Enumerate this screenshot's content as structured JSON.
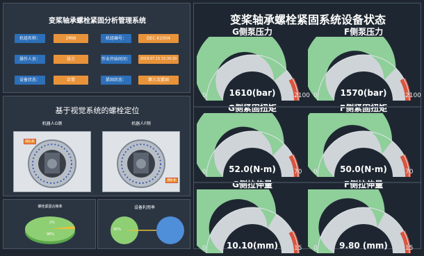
{
  "header": {
    "title": "变桨轴承螺栓紧固分析管理系统"
  },
  "info_rows": [
    {
      "label1": "机组名称：",
      "value1": "2MW",
      "label2": "机组编号：",
      "value2": "DEC-K1004"
    },
    {
      "label1": "操作人员：",
      "value1": "张三",
      "label2": "作业开始时间：",
      "value2": "2019.07.15 15:30:20"
    },
    {
      "label1": "设备状态：",
      "value1": "正常",
      "label2": "紧固状态：",
      "value2": "第三次紧固"
    }
  ],
  "vision": {
    "title": "基于视觉系统的螺栓定位",
    "cam_g": "机器人G侧",
    "cam_f": "机器人F侧",
    "tag_g": "B1-4",
    "tag_f": "B9-4"
  },
  "pie_left": {
    "title": "螺栓紧固合格率",
    "pct_small": "2%",
    "pct_large": "98%"
  },
  "pie_right": {
    "title": "设备利用率",
    "pct": "95%"
  },
  "status": {
    "title": "变桨轴承螺栓紧固系统设备状态"
  },
  "gauges": [
    {
      "title": "G侧泵压力",
      "value": "1610(bar)",
      "min": "0",
      "max": "2100",
      "fraction": 0.767
    },
    {
      "title": "F侧泵压力",
      "value": "1570(bar)",
      "min": "0",
      "max": "2100",
      "fraction": 0.748
    },
    {
      "title": "G侧紧固扭矩",
      "value": "52.0(N·m)",
      "min": "0",
      "max": "70",
      "fraction": 0.743
    },
    {
      "title": "F侧紧固扭矩",
      "value": "50.0(N·m)",
      "min": "0",
      "max": "70",
      "fraction": 0.714
    },
    {
      "title": "G侧拉伸量",
      "value": "10.10(mm)",
      "min": "0",
      "max": "15",
      "fraction": 0.673
    },
    {
      "title": "F侧拉伸量",
      "value": "9.80 (mm)",
      "min": "0",
      "max": "15",
      "fraction": 0.653
    }
  ],
  "colors": {
    "gauge_fill": "#8fcf9a",
    "gauge_danger": "#d9553f",
    "gauge_track": "#cfd4d8",
    "label_blue": "#2d6fb8",
    "value_orange": "#e8933a"
  }
}
